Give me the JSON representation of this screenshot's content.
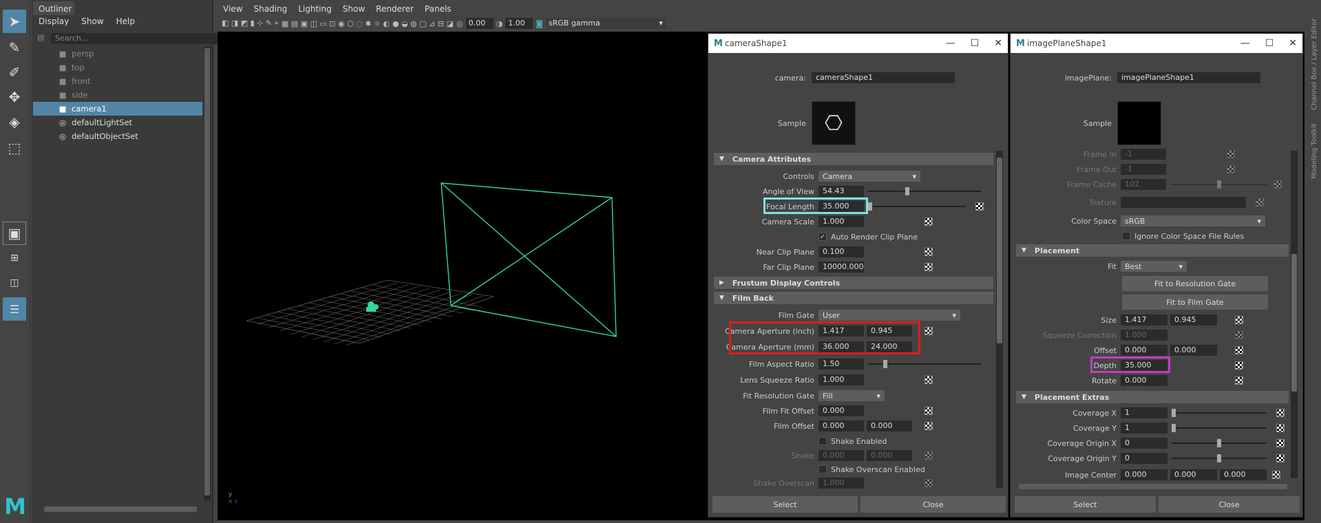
{
  "outliner": {
    "title": "Outliner",
    "menu": [
      "Display",
      "Show",
      "Help"
    ],
    "search_placeholder": "Search...",
    "items": [
      {
        "label": "persp",
        "icon": "camera-icon",
        "dim": true
      },
      {
        "label": "top",
        "icon": "camera-icon",
        "dim": true
      },
      {
        "label": "front",
        "icon": "camera-icon",
        "dim": true
      },
      {
        "label": "side",
        "icon": "camera-icon",
        "dim": true
      },
      {
        "label": "camera1",
        "icon": "camera-icon",
        "selected": true
      },
      {
        "label": "defaultLightSet",
        "icon": "set-icon"
      },
      {
        "label": "defaultObjectSet",
        "icon": "set-icon"
      }
    ]
  },
  "viewport": {
    "menu": [
      "View",
      "Shading",
      "Lighting",
      "Show",
      "Renderer",
      "Panels"
    ],
    "exposure": "0.00",
    "gamma": "1.00",
    "color_space": "sRGB gamma"
  },
  "side_tabs": [
    "Channel Box / Layer Editor",
    "Modeling Toolkit"
  ],
  "camera_window": {
    "title": "cameraShape1",
    "node_label": "camera:",
    "node_value": "cameraShape1",
    "sample_label": "Sample",
    "sections": {
      "camera_attributes": "Camera Attributes",
      "frustum": "Frustum Display Controls",
      "film_back": "Film Back"
    },
    "controls_label": "Controls",
    "controls_value": "Camera",
    "angle_of_view_label": "Angle of View",
    "angle_of_view": "54.43",
    "focal_length_label": "Focal Length",
    "focal_length": "35.000",
    "camera_scale_label": "Camera Scale",
    "camera_scale": "1.000",
    "auto_render_clip": "Auto Render Clip Plane",
    "near_clip_label": "Near Clip Plane",
    "near_clip": "0.100",
    "far_clip_label": "Far Clip Plane",
    "far_clip": "10000.000",
    "film_gate_label": "Film Gate",
    "film_gate": "User",
    "aperture_inch_label": "Camera Aperture (inch)",
    "aperture_inch_x": "1.417",
    "aperture_inch_y": "0.945",
    "aperture_mm_label": "Camera Aperture (mm)",
    "aperture_mm_x": "36.000",
    "aperture_mm_y": "24.000",
    "film_aspect_label": "Film Aspect Ratio",
    "film_aspect": "1.50",
    "lens_squeeze_label": "Lens Squeeze Ratio",
    "lens_squeeze": "1.000",
    "fit_res_gate_label": "Fit Resolution Gate",
    "fit_res_gate": "Fill",
    "film_fit_offset_label": "Film Fit Offset",
    "film_fit_offset": "0.000",
    "film_offset_label": "Film Offset",
    "film_offset_x": "0.000",
    "film_offset_y": "0.000",
    "shake_enabled": "Shake Enabled",
    "shake_label": "Shake",
    "shake_x": "0.000",
    "shake_y": "0.000",
    "shake_overscan_enabled": "Shake Overscan Enabled",
    "shake_overscan_label": "Shake Overscan",
    "shake_overscan": "1.000",
    "select_button": "Select",
    "close_button": "Close"
  },
  "image_window": {
    "title": "imagePlaneShape1",
    "node_label": "imagePlane:",
    "node_value": "imagePlaneShape1",
    "sample_label": "Sample",
    "frame_in_label": "Frame In",
    "frame_in": "-1",
    "frame_out_label": "Frame Out",
    "frame_out": "-1",
    "frame_cache_label": "Frame Cache",
    "frame_cache": "102",
    "texture_label": "Texture",
    "color_space_label": "Color Space",
    "color_space": "sRGB",
    "ignore_rules": "Ignore Color Space File Rules",
    "sections": {
      "placement": "Placement",
      "placement_extras": "Placement Extras"
    },
    "fit_label": "Fit",
    "fit": "Best",
    "fit_res_button": "Fit to Resolution Gate",
    "fit_film_button": "Fit to Film Gate",
    "size_label": "Size",
    "size_x": "1.417",
    "size_y": "0.945",
    "squeeze_label": "Squeeze Correction",
    "squeeze": "1.000",
    "offset_label": "Offset",
    "offset_x": "0.000",
    "offset_y": "0.000",
    "depth_label": "Depth",
    "depth": "35.000",
    "rotate_label": "Rotate",
    "rotate": "0.000",
    "coverage_x_label": "Coverage X",
    "coverage_x": "1",
    "coverage_y_label": "Coverage Y",
    "coverage_y": "1",
    "coverage_origin_x_label": "Coverage Origin X",
    "coverage_origin_x": "0",
    "coverage_origin_y_label": "Coverage Origin Y",
    "coverage_origin_y": "0",
    "image_center_label": "Image Center",
    "image_center_x": "0.000",
    "image_center_y": "0.000",
    "image_center_z": "0.000",
    "select_button": "Select",
    "close_button": "Close"
  },
  "colors": {
    "selection": "#5285a6",
    "camera_wire": "#34d89a",
    "highlight_focal": "#7fe3e3",
    "highlight_aperture": "#e21b1b",
    "highlight_depth": "#c33bc6"
  }
}
